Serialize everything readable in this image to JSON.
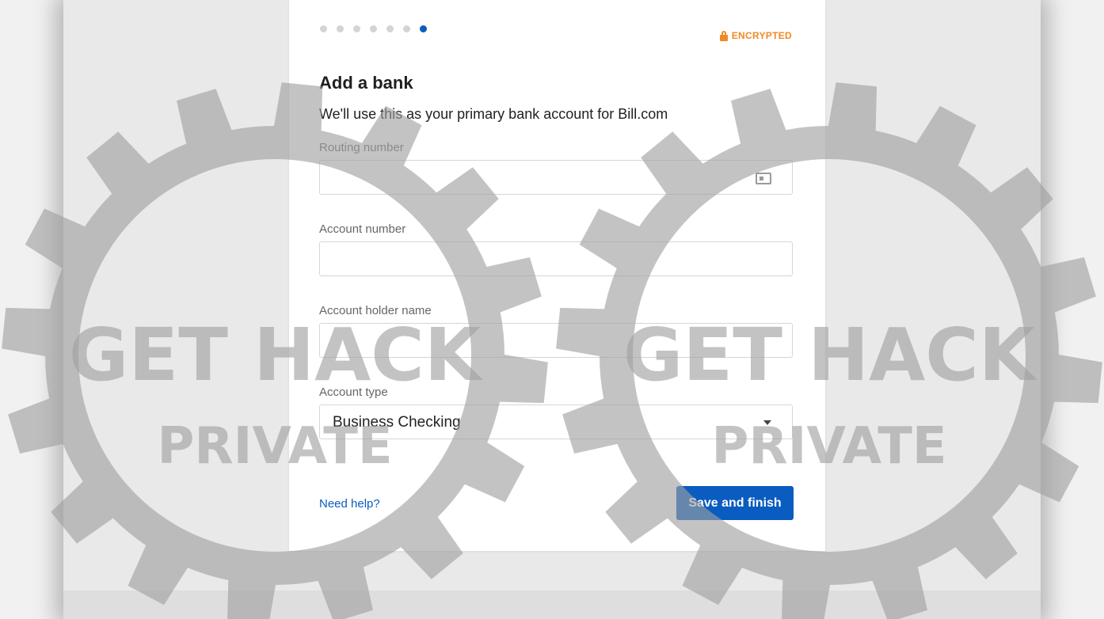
{
  "header": {
    "steps_total": 7,
    "steps_current": 7,
    "encrypted_label": "ENCRYPTED"
  },
  "form": {
    "title": "Add a bank",
    "subtitle": "We'll use this as your primary bank account for Bill.com",
    "routing_label": "Routing number",
    "routing_value": "",
    "account_label": "Account number",
    "account_value": "",
    "holder_label": "Account holder name",
    "holder_value": "",
    "type_label": "Account type",
    "type_value": "Business Checking"
  },
  "footer": {
    "help_link": "Need help?",
    "save_button": "Save and finish"
  },
  "watermark": {
    "line1": "GET HACK",
    "line2": "PRIVATE"
  },
  "colors": {
    "accent": "#0b5cc0",
    "encrypted": "#f08a24",
    "watermark": "#a0a0a0"
  }
}
